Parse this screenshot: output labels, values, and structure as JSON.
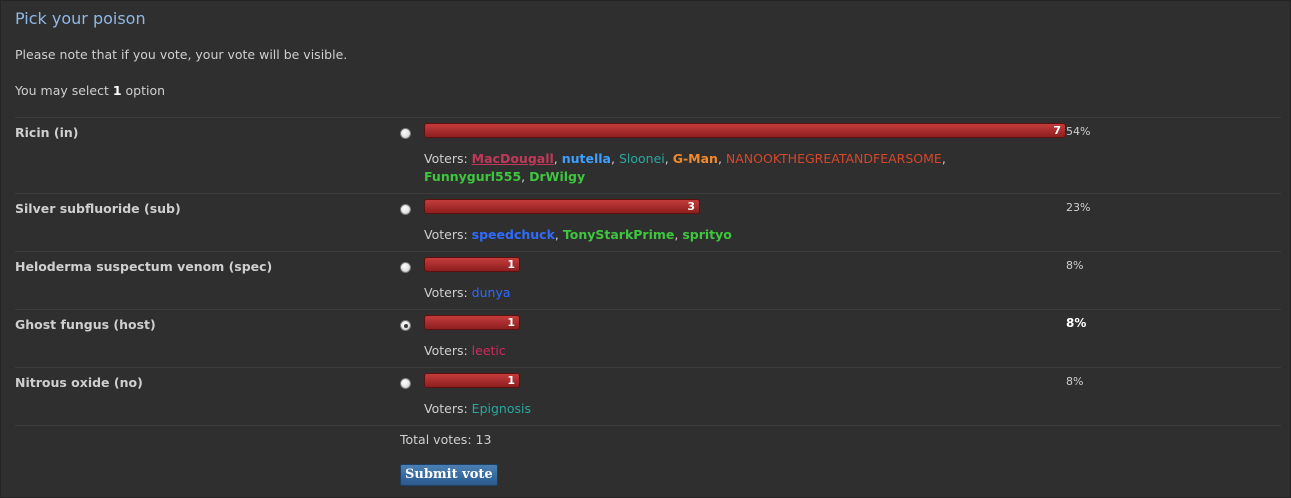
{
  "poll": {
    "title": "Pick your poison",
    "note": "Please note that if you vote, your vote will be visible.",
    "select_prefix": "You may select ",
    "select_count": "1",
    "select_suffix": " option",
    "voters_label": "Voters:",
    "total_label": "Total votes: 13",
    "total_votes": 13,
    "submit_label": "Submit vote",
    "options": [
      {
        "label": "Ricin (in)",
        "count": "7",
        "percent": "54%",
        "fill_fraction": 1.0,
        "selected": false,
        "voters": [
          {
            "name": "MacDougall",
            "color": "#c0395b"
          },
          {
            "name": "nutella",
            "color": "#3ea0ff"
          },
          {
            "name": "Sloonei",
            "color": "#2aa8a0"
          },
          {
            "name": "G-Man",
            "color": "#f08a2c"
          },
          {
            "name": "NANOOKTHEGREATANDFEARSOME",
            "color": "#d6472b"
          },
          {
            "name": "Funnygurl555",
            "color": "#3ec63e"
          },
          {
            "name": "DrWilgy",
            "color": "#3ec63e"
          }
        ]
      },
      {
        "label": "Silver subfluoride (sub)",
        "count": "3",
        "percent": "23%",
        "fill_fraction": 0.43,
        "selected": false,
        "voters": [
          {
            "name": "speedchuck",
            "color": "#2f6bff"
          },
          {
            "name": "TonyStarkPrime",
            "color": "#3ec63e"
          },
          {
            "name": "sprityo",
            "color": "#3ec63e"
          }
        ]
      },
      {
        "label": "Heloderma suspectum venom (spec)",
        "count": "1",
        "percent": "8%",
        "fill_fraction": 0.15,
        "selected": false,
        "voters": [
          {
            "name": "dunya",
            "color": "#2f6bff"
          }
        ]
      },
      {
        "label": "Ghost fungus (host)",
        "count": "1",
        "percent": "8%",
        "fill_fraction": 0.15,
        "selected": true,
        "voters": [
          {
            "name": "leetic",
            "color": "#d4285c"
          }
        ]
      },
      {
        "label": "Nitrous oxide (no)",
        "count": "1",
        "percent": "8%",
        "fill_fraction": 0.15,
        "selected": false,
        "voters": [
          {
            "name": "Epignosis",
            "color": "#2aa8a0"
          }
        ]
      }
    ]
  }
}
